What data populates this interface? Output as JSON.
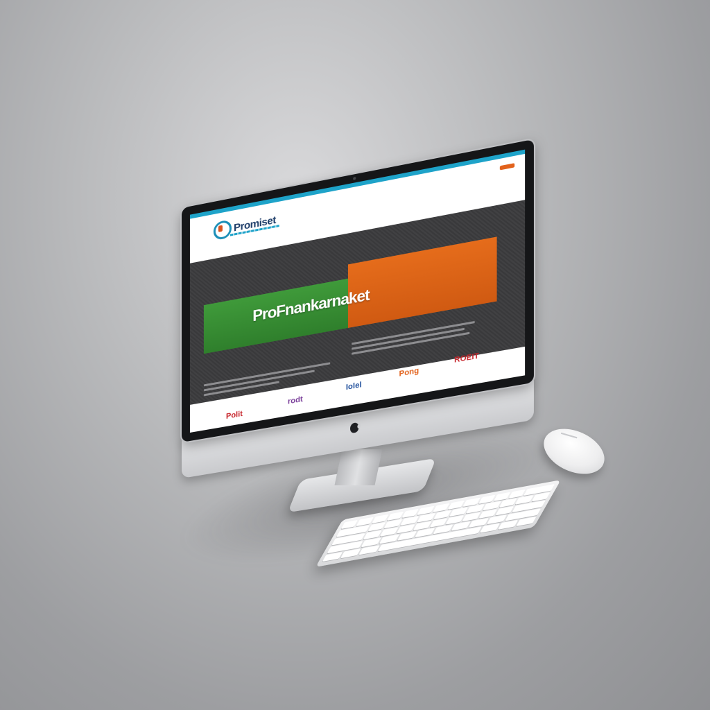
{
  "website": {
    "logo_text": "Promiset",
    "header_cta": "",
    "banner_title": "ProFnankarnaket",
    "brands": [
      "Polit",
      "rodt",
      "Iolel",
      "Pong",
      "ROEIT"
    ]
  },
  "colors": {
    "accent_orange": "#e2621c",
    "accent_green": "#3f9a3a",
    "topbar_blue": "#1ea3c9",
    "hero_dark": "#3b3b3d"
  }
}
